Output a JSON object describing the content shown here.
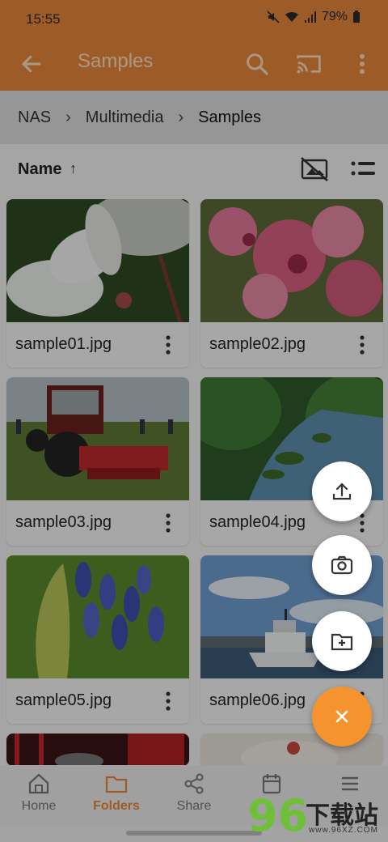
{
  "status_bar": {
    "time": "15:55",
    "battery": "79%"
  },
  "app_bar": {
    "title": "Samples"
  },
  "breadcrumb": {
    "items": [
      "NAS",
      "Multimedia",
      "Samples"
    ]
  },
  "sort": {
    "label": "Name",
    "arrow": "↑"
  },
  "files": [
    {
      "name": "sample01.jpg"
    },
    {
      "name": "sample02.jpg"
    },
    {
      "name": "sample03.jpg"
    },
    {
      "name": "sample04.jpg"
    },
    {
      "name": "sample05.jpg"
    },
    {
      "name": "sample06.jpg"
    }
  ],
  "bottom_nav": {
    "items": [
      {
        "label": "Home",
        "icon": "home-icon"
      },
      {
        "label": "Folders",
        "icon": "folder-icon",
        "active": true
      },
      {
        "label": "Share",
        "icon": "share-icon"
      },
      {
        "label": "",
        "icon": "calendar-icon"
      },
      {
        "label": "",
        "icon": "list-icon"
      }
    ]
  },
  "fab": {
    "actions": [
      "upload-icon",
      "camera-icon",
      "new-folder-icon"
    ],
    "close_icon": "close-icon"
  },
  "watermark": {
    "number": "96",
    "text": "下载站",
    "url": "www.96XZ.COM"
  },
  "colors": {
    "accent": "#e8883a",
    "fab": "#f5932f",
    "active_nav": "#e8883a"
  }
}
